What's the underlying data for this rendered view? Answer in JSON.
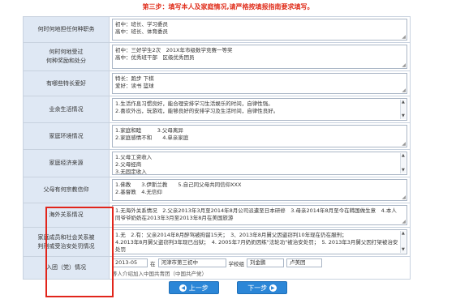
{
  "header": {
    "step_title": "第三步：填写本人及家庭情况,请严格按填报指南要求填写。"
  },
  "rows": [
    {
      "label_lines": [
        "何时何地担任何种职务"
      ],
      "lines": [
        "初中：班长、学习委员",
        "高中：班长、体育委员"
      ]
    },
    {
      "label_lines": [
        "何时何地受过",
        "何种奖励和处分"
      ],
      "lines": [
        "初中：三好学生2次　201X年市级数学竞赛一等奖",
        "高中：优秀班干部　区级优秀团员"
      ]
    },
    {
      "label_lines": [
        "有哪些特长爱好"
      ],
      "lines": [
        "特长：跑步 下棋",
        "爱好：读书 篮球"
      ]
    },
    {
      "label_lines": [
        "业余生活情况"
      ],
      "lines": [
        "1.生活作息习惯良好，能合理安排学习生活娱乐的时间，自律性强。",
        "2.喜欢外出，玩游戏，能够良好的安排学习及生活时间，自律性良好。"
      ]
    },
    {
      "label_lines": [
        "家庭环境情况"
      ],
      "lines": [
        "1.家庭和睦　　　3.父母离异",
        "2.家庭感情不和　　4.单亲家庭"
      ]
    },
    {
      "label_lines": [
        "家庭经济来源"
      ],
      "lines": [
        "1.父母工资收入",
        "2.父母经商",
        "3.无固定收入"
      ]
    },
    {
      "label_lines": [
        "父母有何宗教信仰"
      ],
      "lines": [
        "1.佛教　　3.伊斯兰教　　5.自己同父母共同信仰XXX",
        "2.基督教　4.无信仰"
      ]
    },
    {
      "label_lines": [
        "海外关系情况"
      ],
      "lines": [
        "1.无海外关系情况　2.父亲2013年3月至2014年8月公司派遣至日本研修　3.母亲2014年8月至今在韩国做生意　4.本人同爷爷奶奶在2013年3月至2013年8月在美国旅游"
      ]
    },
    {
      "label_lines": [
        "家庭成员和社会关系被",
        "判刑或受治安处罚情况"
      ],
      "lines": [
        "1.无　2.有：父亲2014年8月醉驾被拘留15天；　3、2013年8月舅父因盗窃判10年现在仍在服刑；",
        "4.2013年8月舅父盗窃判3年现已出狱；　4. 2005年7月奶奶因练\"法轮功\"被治安处罚；　5. 2013年3月舅父因打架被治安处罚"
      ]
    }
  ],
  "party": {
    "label": "入团（党）情况",
    "date": "2013-05",
    "place_prefix": "在",
    "place": "河津市第三初中",
    "school_label": "学校组",
    "school_value": "刘金鹏",
    "office_label": "卢美团",
    "note": "等人介绍加入中国共青团（中国共产党）"
  },
  "buttons": {
    "prev": "上一步",
    "next": "下一步",
    "prev_icon": "◀",
    "next_icon": "▶"
  },
  "colors": {
    "accent": "#2b86d7",
    "highlight": "#e1251b",
    "label_bg": "#dfe8f4"
  }
}
